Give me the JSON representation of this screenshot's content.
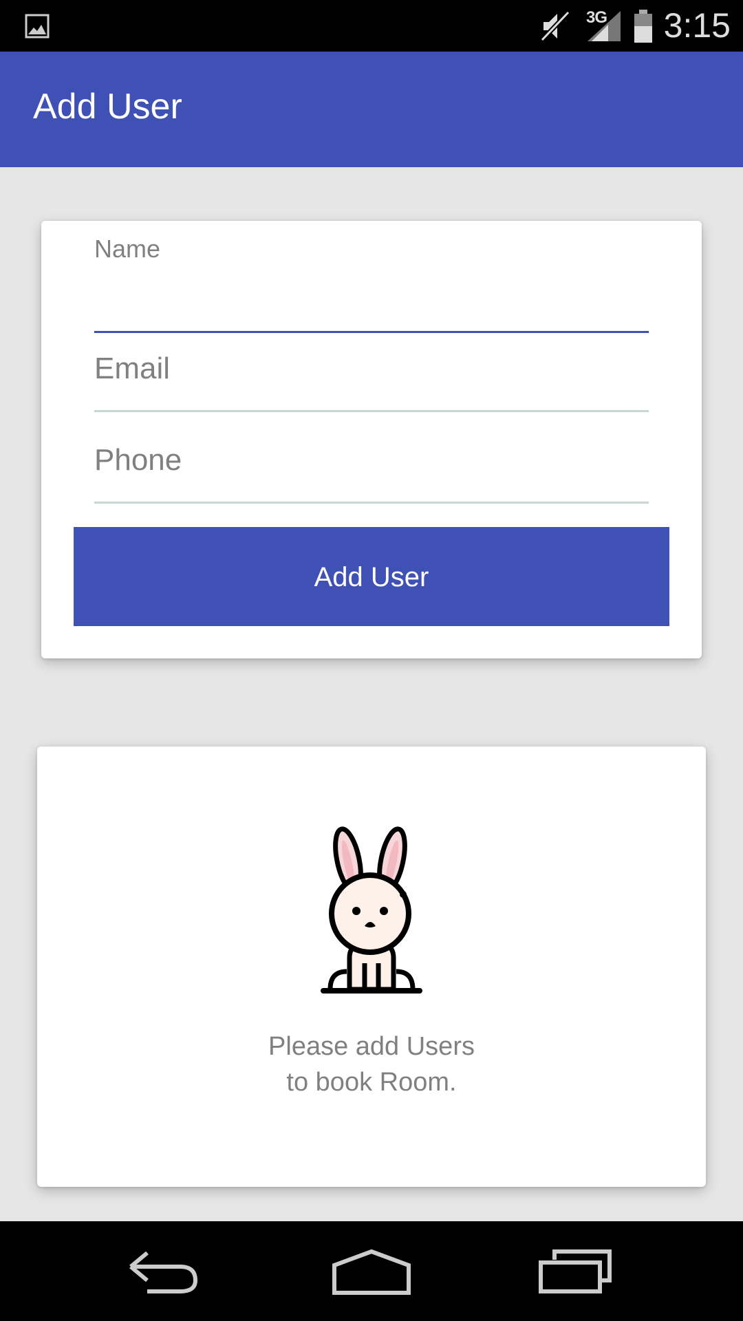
{
  "status_bar": {
    "network": "3G",
    "time": "3:15",
    "icons": [
      "gallery-icon",
      "mute-icon",
      "signal-icon",
      "battery-icon"
    ]
  },
  "app_bar": {
    "title": "Add User"
  },
  "form": {
    "name": {
      "label": "Name",
      "value": ""
    },
    "email": {
      "placeholder": "Email",
      "value": ""
    },
    "phone": {
      "placeholder": "Phone",
      "value": ""
    },
    "submit_label": "Add User"
  },
  "empty_state": {
    "icon": "bunny-icon",
    "line1": "Please add Users",
    "line2": "to book Room."
  },
  "nav_bar": {
    "icons": [
      "back-icon",
      "home-icon",
      "recents-icon"
    ]
  },
  "colors": {
    "primary": "#3F51B5",
    "background": "#E6E6E6",
    "hint_text": "#808080"
  }
}
